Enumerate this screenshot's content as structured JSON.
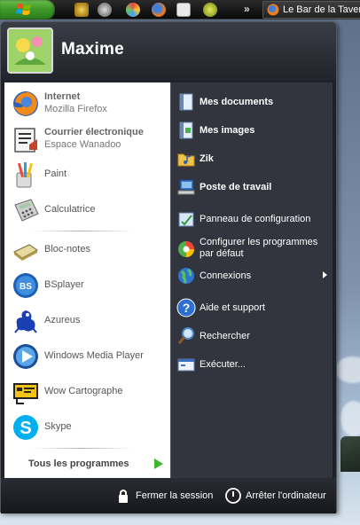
{
  "taskbar": {
    "tray_icons": [
      "warcraft-icon",
      "steam-icon",
      "fan-icon",
      "firefox-icon",
      "counter-strike-icon",
      "dollar-icon"
    ],
    "chevron": "»",
    "task_label": "Le Bar de la Taverne"
  },
  "user": {
    "name": "Maxime"
  },
  "pinned": [
    {
      "title": "Internet",
      "subtitle": "Mozilla Firefox",
      "icon": "firefox-icon"
    },
    {
      "title": "Courrier électronique",
      "subtitle": "Espace Wanadoo",
      "icon": "mail-icon"
    }
  ],
  "recent": [
    {
      "label": "Paint",
      "icon": "paint-icon"
    },
    {
      "label": "Calculatrice",
      "icon": "calculator-icon"
    },
    {
      "label": "Bloc-notes",
      "icon": "notepad-icon"
    },
    {
      "label": "BSplayer",
      "icon": "bsplayer-icon"
    },
    {
      "label": "Azureus",
      "icon": "azureus-icon"
    },
    {
      "label": "Windows Media Player",
      "icon": "media-player-icon"
    },
    {
      "label": "Wow Cartographe",
      "icon": "wow-cartographer-icon"
    },
    {
      "label": "Skype",
      "icon": "skype-icon"
    }
  ],
  "all_programs": "Tous les programmes",
  "places": [
    {
      "label": "Mes documents",
      "bold": true,
      "icon": "documents-icon"
    },
    {
      "label": "Mes images",
      "bold": true,
      "icon": "pictures-icon"
    },
    {
      "label": "Zik",
      "bold": true,
      "icon": "music-folder-icon"
    },
    {
      "label": "Poste de travail",
      "bold": true,
      "icon": "computer-icon"
    }
  ],
  "system": [
    {
      "label": "Panneau de configuration",
      "icon": "control-panel-icon"
    },
    {
      "line1": "Configurer les programmes",
      "line2": "par défaut",
      "icon": "default-programs-icon"
    },
    {
      "label": "Connexions",
      "icon": "connections-icon"
    },
    {
      "label": "Aide et support",
      "icon": "help-icon"
    },
    {
      "label": "Rechercher",
      "icon": "search-icon"
    },
    {
      "label": "Exécuter...",
      "icon": "run-icon"
    }
  ],
  "footer": {
    "logoff": "Fermer la session",
    "shutdown": "Arrêter l'ordinateur"
  }
}
